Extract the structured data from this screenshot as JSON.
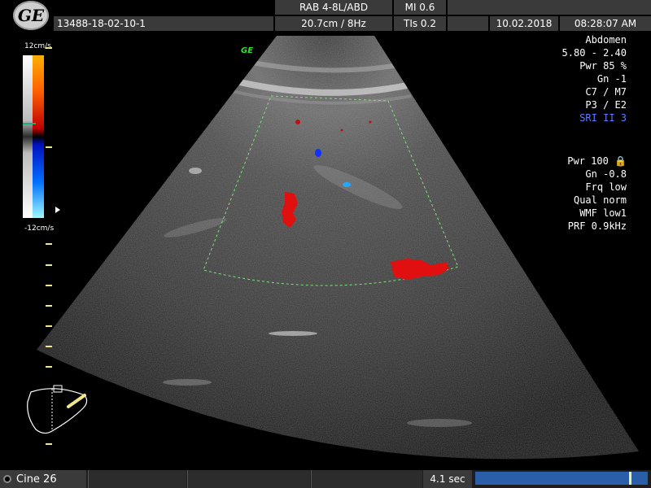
{
  "header": {
    "logo_text": "GE",
    "patient_id": "13488-18-02-10-1",
    "probe": "RAB 4-8L/ABD",
    "depth_rate": "20.7cm / 8Hz",
    "mi": "MI  0.6",
    "tis": "TIs  0.2",
    "date": "10.02.2018",
    "time": "08:28:07 AM"
  },
  "color_bar": {
    "top_label": "12cm/s",
    "bottom_label": "-12cm/s"
  },
  "overlay": {
    "ge_mark": "GE"
  },
  "params_top": [
    "Abdomen",
    "5.80 - 2.40",
    "Pwr  85 %",
    "Gn  -1",
    "C7 / M7",
    "P3 / E2"
  ],
  "params_sri": "SRI II 3",
  "params_color": [
    "Pwr 100 🔒",
    "Gn -0.8",
    "Frq low",
    "Qual norm",
    "WMF low1",
    "PRF  0.9kHz"
  ],
  "bottom": {
    "cine_label": "Cine 26",
    "time_label": "4.1 sec",
    "cine_progress": 0.89
  },
  "colors": {
    "doppler_red": "#e01010",
    "doppler_blue": "#1030ff",
    "roi_green": "#7fe07f",
    "tick_yellow": "#f2e88a",
    "progress_blue": "#2a5ea8"
  }
}
